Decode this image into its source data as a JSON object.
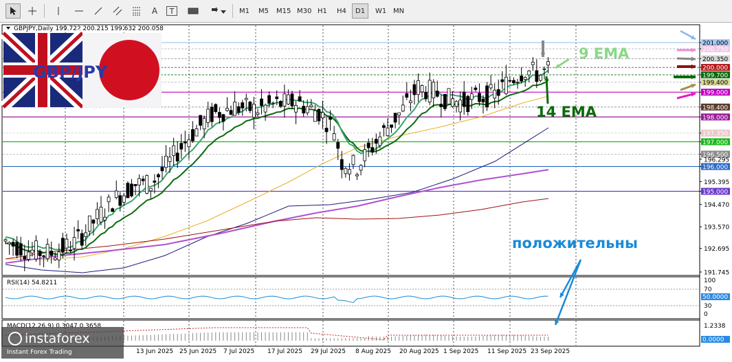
{
  "toolbar": {
    "tools": [
      "cursor-icon",
      "crosshair-icon",
      "vertical-line-icon",
      "horizontal-line-icon",
      "trendline-icon",
      "fibonacci-icon",
      "text-label-icon",
      "text-box-icon",
      "rectangle-icon",
      "arrows-icon"
    ],
    "text_tool": "A",
    "text_box_tool": "T",
    "timeframes": [
      "M1",
      "M5",
      "M15",
      "M30",
      "H1",
      "H4",
      "D1",
      "W1",
      "MN"
    ],
    "active_timeframe": "D1"
  },
  "chart_header": {
    "text": "GBPJPY,Daily  199.722 200.215 199.632 200.058"
  },
  "flag_overlay": {
    "text": "GBP/JPY"
  },
  "annotations": {
    "ema9": "9 EMA",
    "ema14": "14 EMA",
    "positive": "положительны"
  },
  "indicators": {
    "rsi_label": "RSI(14) 54.8211",
    "macd_label": "MACD(12,26,9) 0.3047 0.3658"
  },
  "price_axis": {
    "ticks": [
      "201.000",
      "200.750",
      "200.350",
      "200.000",
      "199.700",
      "199.400",
      "199.000",
      "198.400",
      "198.000",
      "197.350",
      "197.000",
      "196.500",
      "196.295",
      "196.000",
      "195.395",
      "195.000",
      "194.470",
      "193.570",
      "192.695",
      "191.745"
    ],
    "tags": [
      {
        "value": "201.000",
        "color": "#a8c8f0",
        "text_color": "#000000"
      },
      {
        "value": "200.750",
        "color": "#f0c8e8",
        "text_color": "#ffffff"
      },
      {
        "value": "200.350",
        "color": "#d8d8d8",
        "text_color": "#000000"
      },
      {
        "value": "200.000",
        "color": "#b01818",
        "text_color": "#ffffff"
      },
      {
        "value": "199.700",
        "color": "#0a6a0a",
        "text_color": "#ffffff"
      },
      {
        "value": "199.400",
        "color": "#d8d898",
        "text_color": "#000000"
      },
      {
        "value": "199.000",
        "color": "#c000c0",
        "text_color": "#ffffff"
      },
      {
        "value": "198.400",
        "color": "#5a3a2a",
        "text_color": "#ffffff"
      },
      {
        "value": "198.000",
        "color": "#9a1a9a",
        "text_color": "#ffffff"
      },
      {
        "value": "197.350",
        "color": "#e8c8c8",
        "text_color": "#ffffff"
      },
      {
        "value": "197.000",
        "color": "#18b818",
        "text_color": "#ffffff"
      },
      {
        "value": "196.500",
        "color": "#8a8a8a",
        "text_color": "#ffffff"
      },
      {
        "value": "196.000",
        "color": "#2a6ac8",
        "text_color": "#ffffff"
      },
      {
        "value": "195.000",
        "color": "#6a3ac8",
        "text_color": "#ffffff"
      }
    ],
    "rsi_ticks": [
      "100",
      "70",
      "30",
      "0"
    ],
    "rsi_tag": "50.0000",
    "macd_ticks": [
      "1.2338"
    ],
    "macd_tag": "0.0000"
  },
  "time_axis": {
    "labels": [
      "13 Jun 2025",
      "25 Jun 2025",
      "7 Jul 2025",
      "17 Jul 2025",
      "29 Jul 2025",
      "8 Aug 2025",
      "20 Aug 2025",
      "1 Sep 2025",
      "11 Sep 2025",
      "23 Sep 2025"
    ]
  },
  "watermark": {
    "brand": "instaforex",
    "tagline": "Instant Forex Trading"
  },
  "colors": {
    "ema9": "#3aa56a",
    "ema14": "#0a6a0a",
    "ma_gold": "#e8b020",
    "ma_navy": "#1a1a7a",
    "ma_purple": "#b050d0",
    "ma_red": "#a01010",
    "annotation_green": "#0a6a0a",
    "annotation_lightgreen": "#88d888",
    "annotation_blue": "#1a8ad8"
  }
}
